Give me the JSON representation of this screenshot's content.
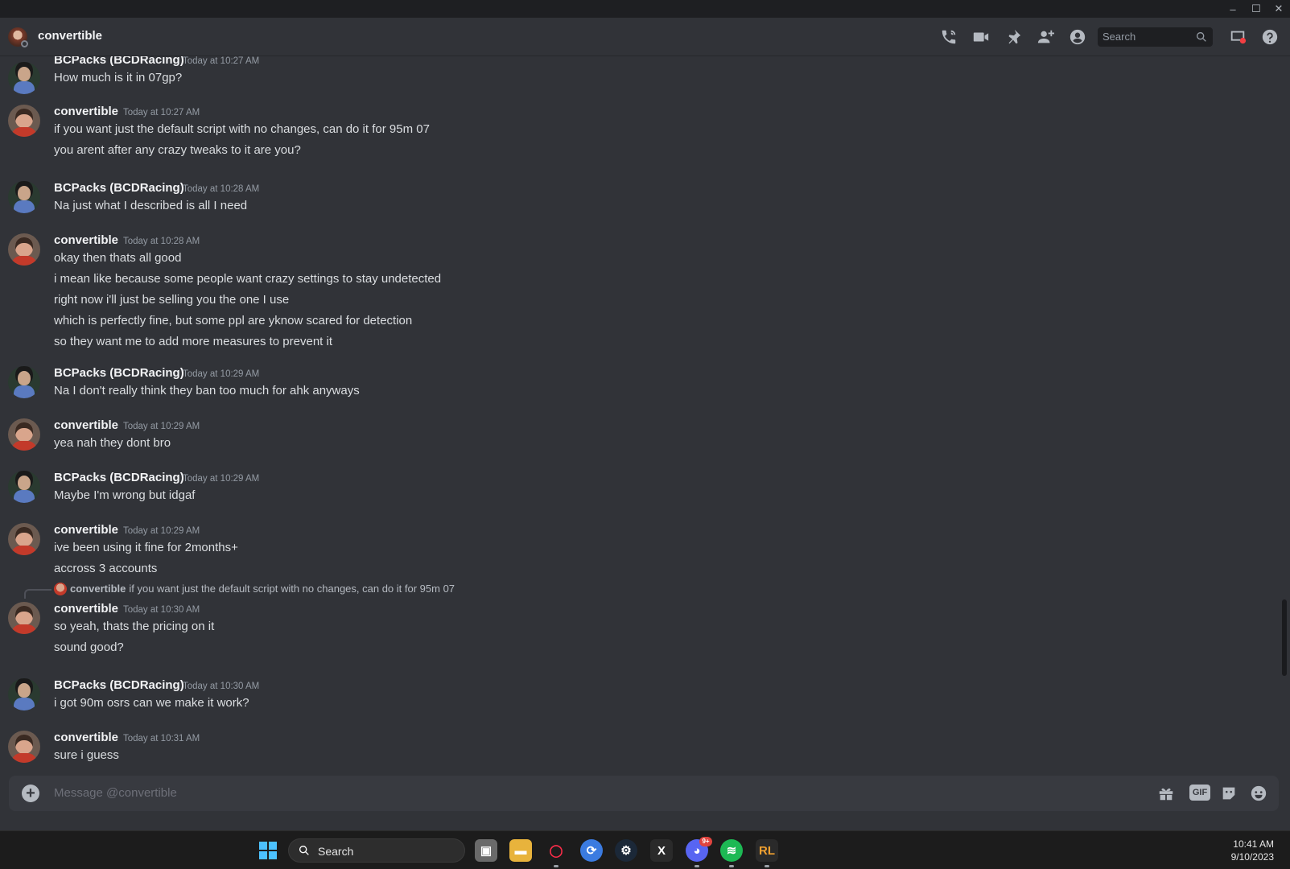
{
  "window": {
    "minimize": "–",
    "maximize": "☐",
    "close": "✕"
  },
  "header": {
    "title": "convertible",
    "search_placeholder": "Search",
    "icons": [
      "phone-call-icon",
      "video-icon",
      "pin-icon",
      "add-friend-icon",
      "profile-icon",
      "inbox-icon",
      "help-icon"
    ]
  },
  "messages": [
    {
      "author": "BCPacks (BCDRacing)",
      "time": "Today at 10:27 AM",
      "lines": [
        "How much is it in 07gp?"
      ]
    },
    {
      "author": "convertible",
      "time": "Today at 10:27 AM",
      "lines": [
        "if you want just the default script with no changes, can do it for 95m 07",
        "you arent after any crazy tweaks to it are you?"
      ]
    },
    {
      "author": "BCPacks (BCDRacing)",
      "time": "Today at 10:28 AM",
      "lines": [
        "Na just what I described is all I need"
      ]
    },
    {
      "author": "convertible",
      "time": "Today at 10:28 AM",
      "lines": [
        "okay then thats all good",
        "i mean like because some people want crazy settings to stay undetected",
        "right now i'll just be selling you the one I use",
        "which is perfectly fine, but some ppl are yknow scared for detection",
        "so they want me to add more measures to prevent it"
      ]
    },
    {
      "author": "BCPacks (BCDRacing)",
      "time": "Today at 10:29 AM",
      "lines": [
        "Na I don't really think they ban too much for ahk anyways"
      ]
    },
    {
      "author": "convertible",
      "time": "Today at 10:29 AM",
      "lines": [
        "yea nah they dont bro"
      ]
    },
    {
      "author": "BCPacks (BCDRacing)",
      "time": "Today at 10:29 AM",
      "lines": [
        "Maybe I'm wrong but idgaf"
      ]
    },
    {
      "author": "convertible",
      "time": "Today at 10:29 AM",
      "lines": [
        "ive been using it fine for 2months+",
        "accross 3 accounts"
      ]
    },
    {
      "author": "convertible",
      "time": "Today at 10:30 AM",
      "lines": [
        "so yeah, thats the pricing on it",
        "sound good?"
      ]
    },
    {
      "author": "BCPacks (BCDRacing)",
      "time": "Today at 10:30 AM",
      "lines": [
        "i got 90m osrs can we make it work?"
      ]
    },
    {
      "author": "convertible",
      "time": "Today at 10:31 AM",
      "lines": [
        "sure i guess"
      ]
    }
  ],
  "reply": {
    "author": "convertible",
    "text": "if you want just the default script with no changes, can do it for 95m 07"
  },
  "composer": {
    "placeholder": "Message @convertible",
    "gif_label": "GIF"
  },
  "taskbar": {
    "search_label": "Search",
    "apps": [
      "task-view",
      "file-explorer",
      "opera-gx",
      "app-blue",
      "steam",
      "app-x",
      "discord",
      "spotify",
      "runelite"
    ],
    "discord_badge": "9+",
    "time": "10:41 AM",
    "date": "9/10/2023"
  }
}
